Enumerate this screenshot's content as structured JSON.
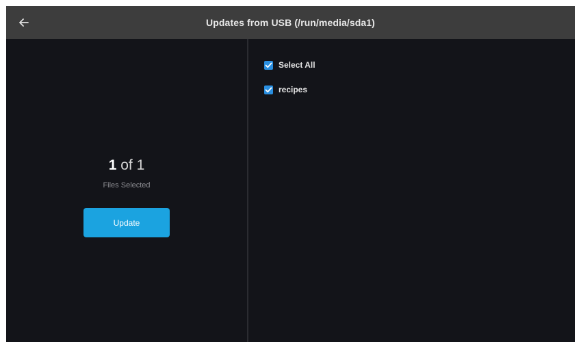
{
  "header": {
    "title": "Updates from USB (/run/media/sda1)",
    "back_icon": "arrow-left-icon"
  },
  "summary": {
    "selected_count": "1",
    "total_text": " of 1",
    "caption": "Files Selected",
    "update_label": "Update"
  },
  "file_list": {
    "select_all": {
      "label": "Select All",
      "checked": true
    },
    "items": [
      {
        "label": "recipes",
        "checked": true
      }
    ]
  },
  "colors": {
    "header_bg": "#3d3d3d",
    "panel_bg": "#131419",
    "accent": "#1ba3e0",
    "checkbox": "#2a8fe0"
  }
}
